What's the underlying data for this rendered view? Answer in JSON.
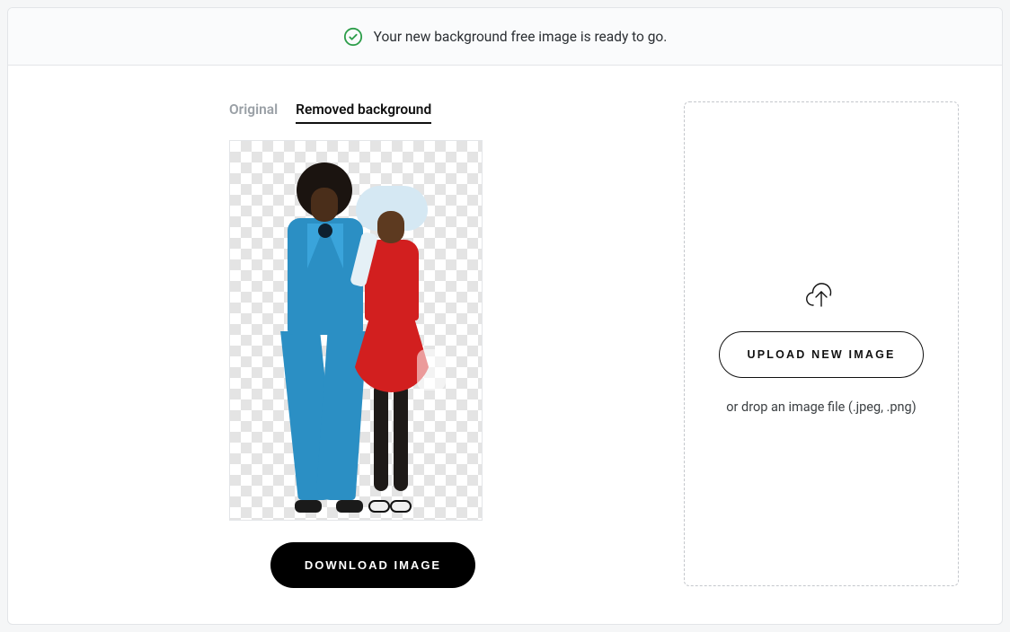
{
  "banner": {
    "message": "Your new background free image is ready to go."
  },
  "tabs": {
    "original": "Original",
    "removed": "Removed background"
  },
  "buttons": {
    "download": "DOWNLOAD IMAGE",
    "upload": "UPLOAD NEW IMAGE"
  },
  "dropzone": {
    "hint": "or drop an image file (.jpeg, .png)"
  }
}
